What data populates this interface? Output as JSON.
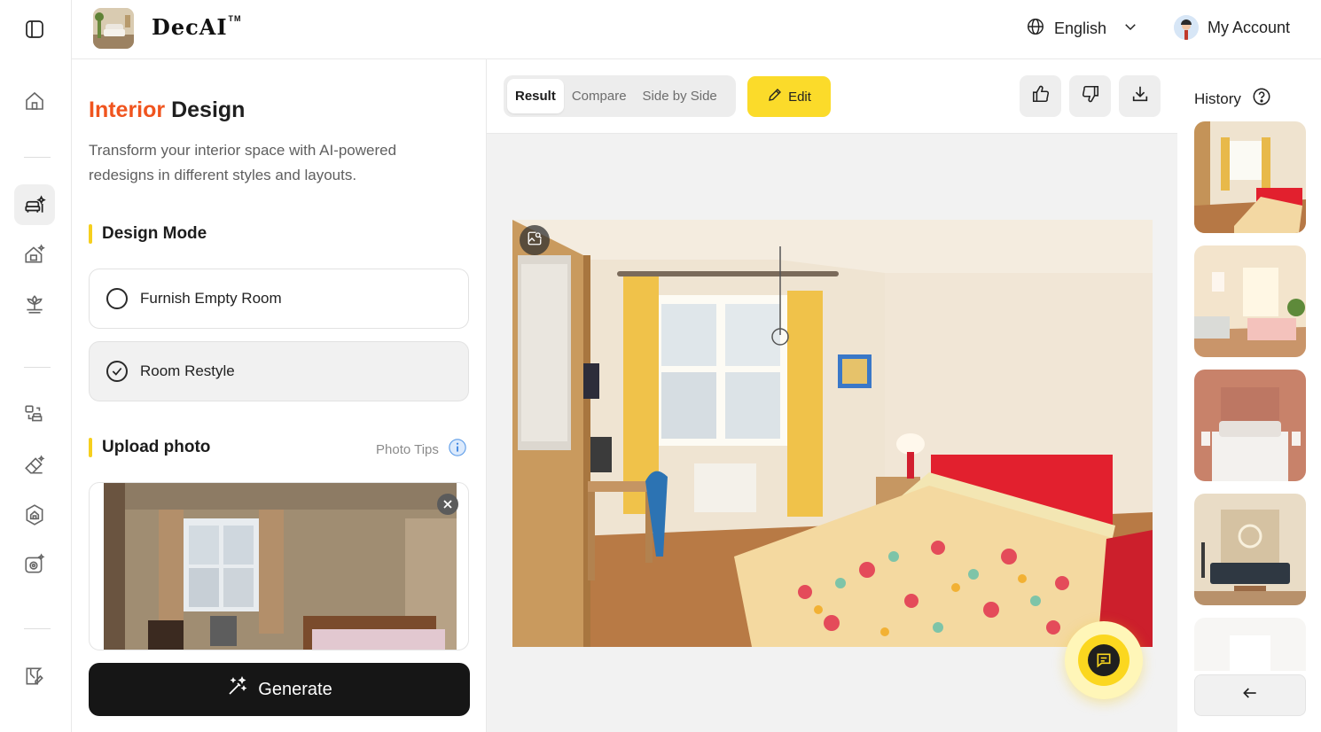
{
  "app": {
    "name": "DecAI",
    "trademark": "TM"
  },
  "header": {
    "language": "English",
    "account_label": "My Account"
  },
  "panel": {
    "title_accent": "Interior",
    "title_rest": "Design",
    "description": "Transform your interior space with AI-powered redesigns in different styles and layouts.",
    "design_mode_label": "Design Mode",
    "modes": [
      {
        "label": "Furnish Empty Room",
        "selected": false
      },
      {
        "label": "Room Restyle",
        "selected": true
      }
    ],
    "upload_label": "Upload photo",
    "photo_tips": "Photo Tips",
    "generate_label": "Generate"
  },
  "toolbar": {
    "tabs": [
      {
        "label": "Result",
        "active": true
      },
      {
        "label": "Compare",
        "active": false
      },
      {
        "label": "Side by Side",
        "active": false
      }
    ],
    "edit_label": "Edit"
  },
  "history": {
    "title": "History",
    "thumb_count": 5
  },
  "colors": {
    "accent_orange": "#f0541e",
    "accent_yellow": "#fbdb2a",
    "dark": "#161616"
  }
}
